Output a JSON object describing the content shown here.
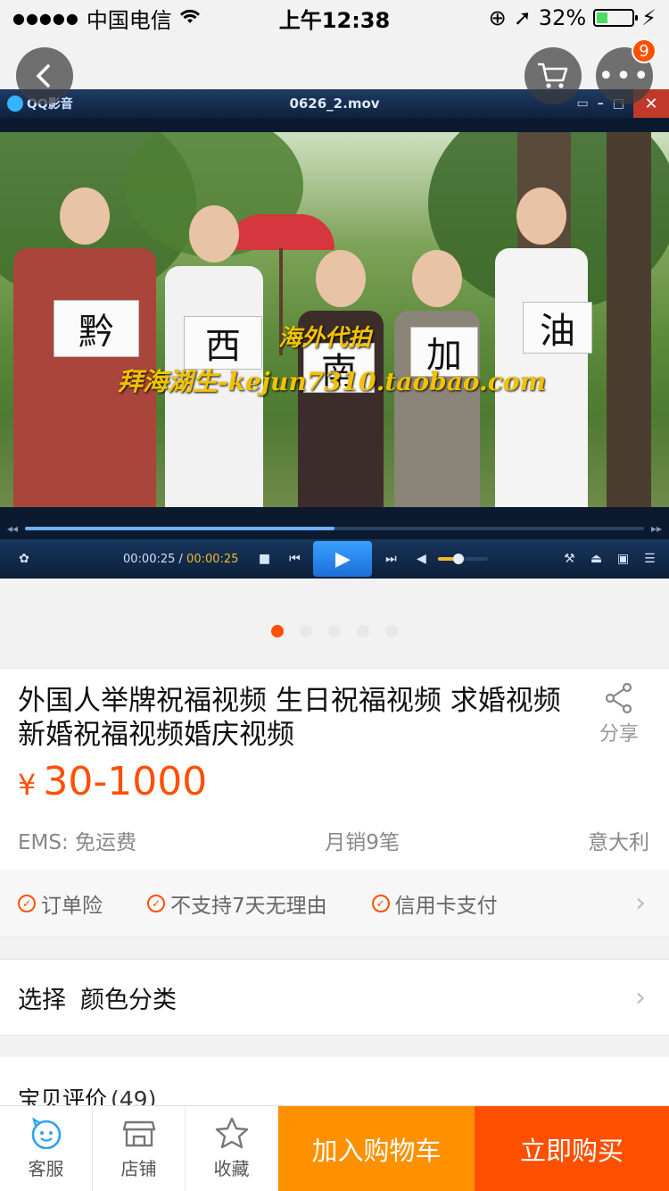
{
  "status_bar": {
    "carrier": "中国电信",
    "time": "上午12:38",
    "battery": "32%"
  },
  "header": {
    "cart_badge": "9"
  },
  "player": {
    "app_name": "QQ影音",
    "file_name": "0626_2.mov",
    "time_current": "00:00:25",
    "time_separator": " / ",
    "time_total": "00:00:25",
    "progress": 0.5,
    "volume": 0.4,
    "watermark_line1": "海外代拍",
    "watermark_line2": "拜海湖生-kejun7310.taobao.com",
    "signs": [
      "黔",
      "西",
      "南",
      "加",
      "油"
    ]
  },
  "gallery": {
    "page_count": 5,
    "active_index": 0
  },
  "product": {
    "title": "外国人举牌祝福视频 生日祝福视频 求婚视频新婚祝福视频婚庆视频",
    "share_label": "分享",
    "currency": "¥",
    "price": "30-1000",
    "shipping": "EMS: 免运费",
    "monthly_sales": "月销9笔",
    "location": "意大利"
  },
  "services": {
    "items": [
      "订单险",
      "不支持7天无理由",
      "信用卡支付"
    ]
  },
  "select": {
    "label": "选择",
    "value": "颜色分类"
  },
  "reviews": {
    "label": "宝贝评价",
    "count": "(49)"
  },
  "bottom_bar": {
    "service_label": "客服",
    "shop_label": "店铺",
    "favorite_label": "收藏",
    "add_to_cart_label": "加入购物车",
    "buy_now_label": "立即购买"
  },
  "colors": {
    "accent": "#ff5000",
    "cart": "#ff9000",
    "price": "#ff5000"
  }
}
